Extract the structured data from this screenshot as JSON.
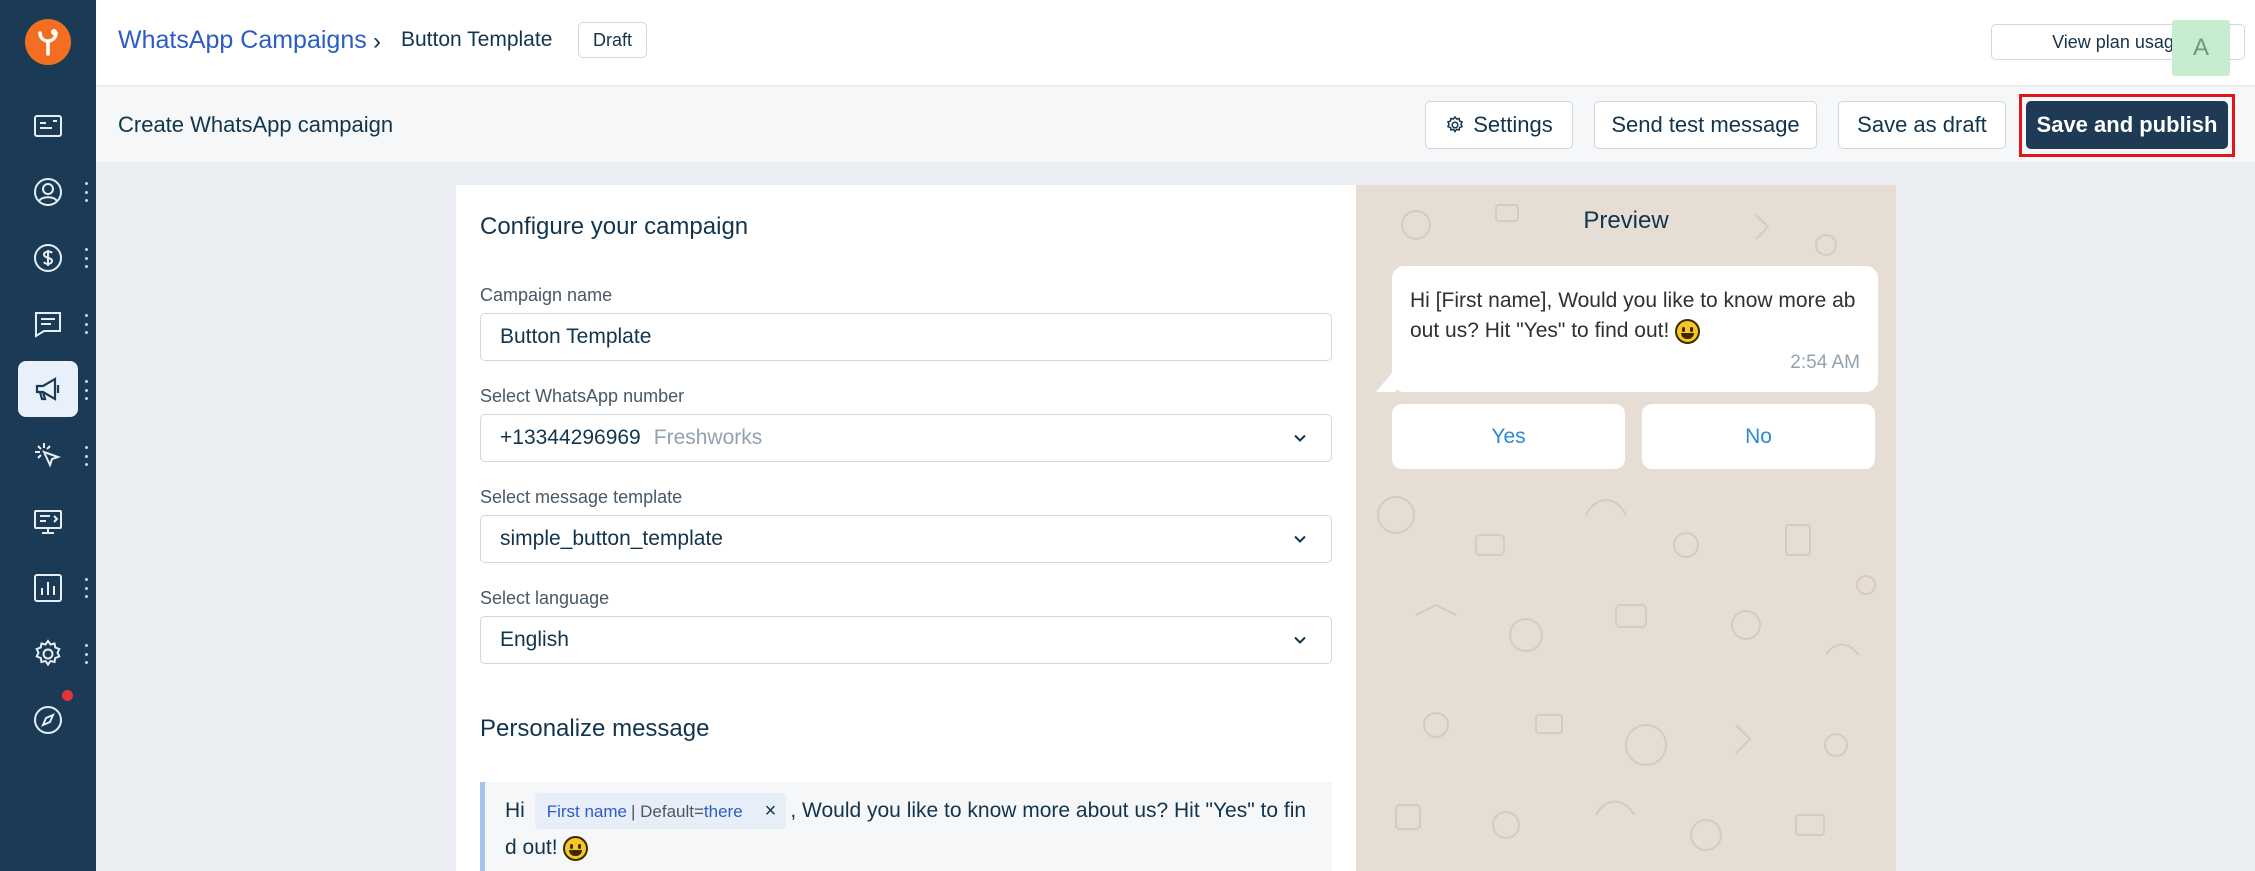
{
  "header": {
    "breadcrumb_root": "WhatsApp Campaigns",
    "breadcrumb_separator": "›",
    "breadcrumb_current": "Button Template",
    "status_badge": "Draft",
    "plan_usage_label": "View plan usage",
    "avatar_initial": "A"
  },
  "subheader": {
    "title": "Create WhatsApp campaign",
    "settings_label": "Settings",
    "test_label": "Send test message",
    "draft_label": "Save as draft",
    "publish_label": "Save and publish"
  },
  "sidebar": {
    "items": [
      {
        "icon": "contact-card-icon"
      },
      {
        "icon": "user-icon"
      },
      {
        "icon": "dollar-icon"
      },
      {
        "icon": "chat-icon"
      },
      {
        "icon": "megaphone-icon",
        "active": true
      },
      {
        "icon": "cursor-click-icon"
      },
      {
        "icon": "monitor-icon"
      },
      {
        "icon": "bar-chart-icon"
      },
      {
        "icon": "gear-icon"
      },
      {
        "icon": "compass-icon"
      }
    ]
  },
  "form": {
    "title": "Configure your campaign",
    "campaign_name_label": "Campaign name",
    "campaign_name_value": "Button Template",
    "number_label": "Select WhatsApp number",
    "number_value": "+13344296969",
    "number_account": "Freshworks",
    "template_label": "Select message template",
    "template_value": "simple_button_template",
    "language_label": "Select language",
    "language_value": "English",
    "personalize_title": "Personalize message",
    "message_prefix": "Hi",
    "chip_key": "First name",
    "chip_default_label": "| Default=",
    "chip_default_value": "there",
    "chip_remove": "×",
    "message_suffix_1": ", Would you like to know more about us? Hit \"Yes\" to fin",
    "message_suffix_2": "d out!"
  },
  "preview": {
    "title": "Preview",
    "message_line1": "Hi [First name], Would you like to know more ab",
    "message_line2": "out us? Hit \"Yes\" to find out!",
    "time": "2:54 AM",
    "buttons": [
      "Yes",
      "No"
    ]
  },
  "colors": {
    "sidebar_bg": "#1b3a55",
    "brand_orange": "#f26f21",
    "link_blue": "#2c5cc5",
    "primary_dark": "#1e3a55",
    "highlight_red": "#e1141c",
    "preview_bg": "#e6ddd4"
  }
}
